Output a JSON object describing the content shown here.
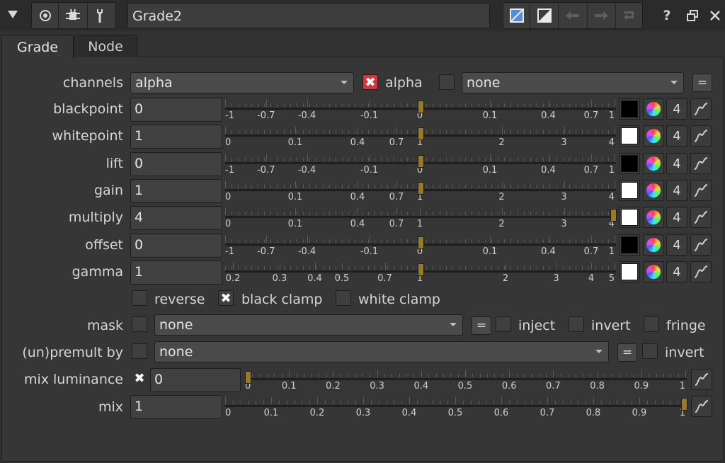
{
  "titlebar": {
    "node_name": "Grade2",
    "help_label": "?",
    "icons": [
      "collapse-triangle-icon",
      "node-target-icon",
      "bug-icon",
      "wrench-icon",
      "color-sample-icon",
      "split-view-icon",
      "undo-icon",
      "redo-icon",
      "revert-icon",
      "help-icon",
      "float-window-icon",
      "close-icon"
    ]
  },
  "tabs": [
    {
      "label": "Grade",
      "active": true
    },
    {
      "label": "Node",
      "active": false
    }
  ],
  "channels": {
    "label": "channels",
    "value": "alpha",
    "checkbox_label": "alpha",
    "checkbox_checked": true,
    "second_value": "none",
    "eq_label": "="
  },
  "knobs": [
    {
      "label": "blackpoint",
      "value": "0",
      "scale": "neg",
      "handle": 0.5,
      "swatch": "#000000",
      "count": "4"
    },
    {
      "label": "whitepoint",
      "value": "1",
      "scale": "pos4",
      "handle": 0.5,
      "swatch": "#ffffff",
      "count": "4"
    },
    {
      "label": "lift",
      "value": "0",
      "scale": "neg",
      "handle": 0.5,
      "swatch": "#000000",
      "count": "4"
    },
    {
      "label": "gain",
      "value": "1",
      "scale": "pos4",
      "handle": 0.5,
      "swatch": "#ffffff",
      "count": "4"
    },
    {
      "label": "multiply",
      "value": "4",
      "scale": "pos4",
      "handle": 1.0,
      "swatch": "#ffffff",
      "count": "4"
    },
    {
      "label": "offset",
      "value": "0",
      "scale": "neg",
      "handle": 0.5,
      "swatch": "#000000",
      "count": "4"
    },
    {
      "label": "gamma",
      "value": "1",
      "scale": "gam5",
      "handle": 0.5,
      "swatch": "#ffffff",
      "count": "4"
    }
  ],
  "scales": {
    "neg": [
      [
        "-1",
        0.0
      ],
      [
        "-0.7",
        0.105
      ],
      [
        "-0.4",
        0.21
      ],
      [
        "-0.1",
        0.37
      ],
      [
        "0",
        0.5
      ],
      [
        "0.1",
        0.68
      ],
      [
        "0.4",
        0.83
      ],
      [
        "0.7",
        0.94
      ],
      [
        "1",
        1.0
      ]
    ],
    "pos4": [
      [
        "0",
        0.0
      ],
      [
        "0.1",
        0.18
      ],
      [
        "0.4",
        0.34
      ],
      [
        "0.7",
        0.44
      ],
      [
        "1",
        0.5
      ],
      [
        "2",
        0.71
      ],
      [
        "3",
        0.87
      ],
      [
        "4",
        1.0
      ]
    ],
    "gam5": [
      [
        "0.2",
        0.02
      ],
      [
        "0.3",
        0.14
      ],
      [
        "0.4",
        0.23
      ],
      [
        "0.5",
        0.3
      ],
      [
        "0.7",
        0.41
      ],
      [
        "1",
        0.5
      ],
      [
        "2",
        0.72
      ],
      [
        "3",
        0.85
      ],
      [
        "4",
        0.94
      ],
      [
        "5",
        1.0
      ]
    ],
    "unit": [
      [
        "0",
        0.0
      ],
      [
        "0.1",
        0.1
      ],
      [
        "0.2",
        0.2
      ],
      [
        "0.3",
        0.3
      ],
      [
        "0.4",
        0.4
      ],
      [
        "0.5",
        0.5
      ],
      [
        "0.6",
        0.6
      ],
      [
        "0.7",
        0.7
      ],
      [
        "0.8",
        0.8
      ],
      [
        "0.9",
        0.9
      ],
      [
        "1",
        1.0
      ]
    ]
  },
  "options": {
    "reverse_label": "reverse",
    "reverse_checked": false,
    "black_clamp_label": "black clamp",
    "black_clamp_checked": true,
    "white_clamp_label": "white clamp",
    "white_clamp_checked": false
  },
  "mask": {
    "label": "mask",
    "value": "none",
    "eq_label": "=",
    "inject_label": "inject",
    "invert_label": "invert",
    "fringe_label": "fringe"
  },
  "premult": {
    "label": "(un)premult by",
    "value": "none",
    "eq_label": "=",
    "invert_label": "invert"
  },
  "mix_luminance": {
    "label": "mix luminance",
    "enabled": true,
    "value": "0",
    "handle": 0.0
  },
  "mix": {
    "label": "mix",
    "value": "1",
    "handle": 1.0
  },
  "colors": {
    "background": "#363636",
    "handle": "#9a7a1a",
    "checkbox_red": "#d8343b"
  }
}
